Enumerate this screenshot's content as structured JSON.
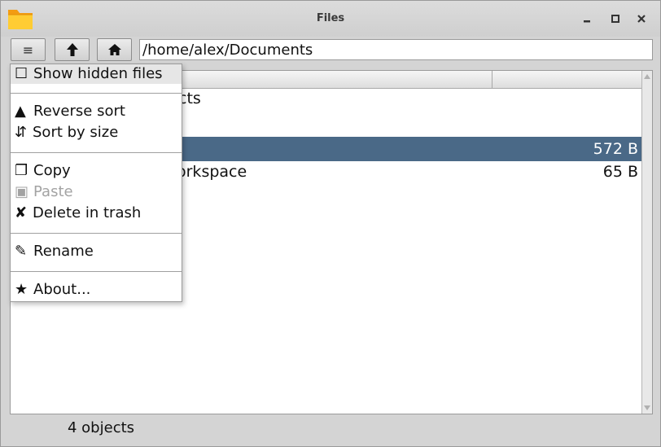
{
  "window": {
    "title": "Files",
    "icon": "folder-icon",
    "controls": [
      "minimize-icon",
      "maximize-icon",
      "close-icon"
    ]
  },
  "toolbar": {
    "menu_glyph": "≡",
    "up_icon": "arrow-up-icon",
    "home_icon": "home-icon",
    "path": "/home/alex/Documents"
  },
  "file_list": {
    "rows": [
      {
        "name": "Projects",
        "visible_name": "cts",
        "size": ""
      },
      {
        "name": "",
        "visible_name": "",
        "size": ""
      },
      {
        "name": "",
        "visible_name": "",
        "size": "572 B",
        "selected": true
      },
      {
        "name": "workspace",
        "visible_name": "orkspace",
        "size": "65 B"
      }
    ]
  },
  "menu": {
    "items": [
      {
        "icon": "☐",
        "label": "Show hidden files"
      },
      {
        "icon": "▲",
        "label": "Reverse sort"
      },
      {
        "icon": "⇵",
        "label": "Sort by size"
      },
      {
        "icon": "❐",
        "label": "Copy"
      },
      {
        "icon": "▣",
        "label": "Paste"
      },
      {
        "icon": "✘",
        "label": "Delete in trash"
      },
      {
        "icon": "✎",
        "label": "Rename"
      },
      {
        "icon": "★",
        "label": "About..."
      }
    ]
  },
  "status": {
    "text": "4 objects"
  },
  "colors": {
    "selection": "#4a6987",
    "window_bg": "#d4d4d4",
    "folder_icon": "#f7a81b"
  }
}
